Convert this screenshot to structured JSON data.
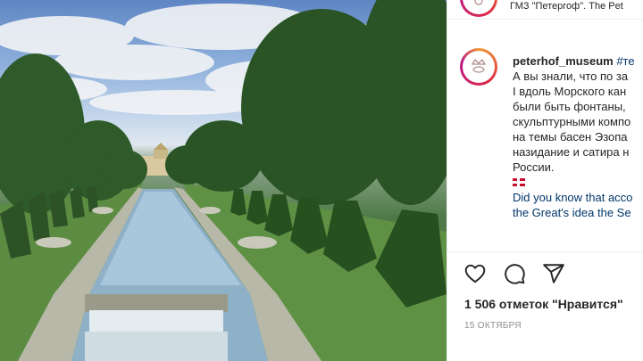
{
  "header": {
    "location": "ГМЗ \"Петергоф\". The Pet"
  },
  "post": {
    "username": "peterhof_museum",
    "hashtag": "#те",
    "caption_lines": [
      "А вы знали, что по за",
      "I вдоль Морского кан",
      "были быть фонтаны,",
      "скульптурными компо",
      "на темы басен Эзопа",
      "назидание и сатира н",
      "России."
    ],
    "caption_en_lines": [
      "Did you know that acco",
      "the Great's idea the Se"
    ],
    "likes": "1 506 отметок \"Нравится\"",
    "date": "15 ОКТЯБРЯ"
  },
  "icons": {
    "like": "heart-icon",
    "comment": "comment-icon",
    "share": "share-icon",
    "flag": "uk-flag-icon"
  },
  "colors": {
    "link": "#00376b",
    "text": "#262626",
    "muted": "#8e8e8e"
  }
}
